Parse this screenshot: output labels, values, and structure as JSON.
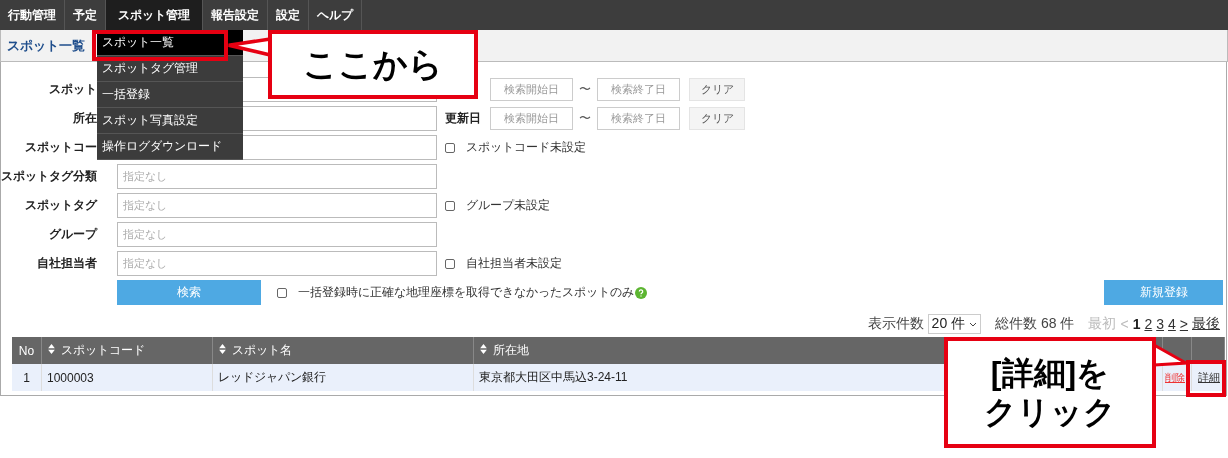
{
  "nav": {
    "tabs": [
      {
        "label": "行動管理",
        "selected": false
      },
      {
        "label": "予定",
        "selected": false
      },
      {
        "label": "スポット管理",
        "selected": true
      },
      {
        "label": "報告設定",
        "selected": false
      },
      {
        "label": "設定",
        "selected": false
      },
      {
        "label": "ヘルプ",
        "selected": false
      }
    ]
  },
  "page_title": "スポット一覧",
  "menu": {
    "items": [
      {
        "label": "スポット一覧",
        "selected": true
      },
      {
        "label": "スポットタグ管理",
        "selected": false
      },
      {
        "label": "一括登録",
        "selected": false
      },
      {
        "label": "スポット写真設定",
        "selected": false
      },
      {
        "label": "操作ログダウンロード",
        "selected": false
      }
    ]
  },
  "form": {
    "rows": [
      {
        "label": "スポット",
        "right": {
          "kind": "date_range",
          "start_placeholder": "検索開始日",
          "separator": "〜",
          "end_placeholder": "検索終了日",
          "clear": "クリア"
        }
      },
      {
        "label": "所在",
        "right": {
          "kind": "date_range",
          "label": "更新日",
          "start_placeholder": "検索開始日",
          "separator": "〜",
          "end_placeholder": "検索終了日",
          "clear": "クリア"
        }
      },
      {
        "label": "スポットコー",
        "right": {
          "kind": "checkbox",
          "label": "スポットコード未設定",
          "checked": false
        }
      },
      {
        "label": "スポットタグ分類",
        "placeholder": "指定なし"
      },
      {
        "label": "スポットタグ",
        "placeholder": "指定なし",
        "right": {
          "kind": "checkbox",
          "label": "グループ未設定",
          "checked": false
        }
      },
      {
        "label": "グループ",
        "placeholder": "指定なし"
      },
      {
        "label": "自社担当者",
        "placeholder": "指定なし",
        "right": {
          "kind": "checkbox",
          "label": "自社担当者未設定",
          "checked": false
        }
      }
    ],
    "search_button": "検索",
    "geo_checkbox": {
      "label": "一括登録時に正確な地理座標を取得できなかったスポットのみ",
      "checked": false
    },
    "new_button": "新規登録"
  },
  "pager": {
    "per_page_label": "表示件数",
    "per_page": "20 件",
    "total": "総件数 68 件",
    "first": "最初",
    "prev": "<",
    "pages": [
      {
        "label": "1",
        "selected": true
      },
      {
        "label": "2",
        "selected": false
      },
      {
        "label": "3",
        "selected": false
      },
      {
        "label": "4",
        "selected": false
      }
    ],
    "next": ">",
    "last": "最後"
  },
  "table": {
    "columns": [
      {
        "label": "No",
        "sortable": false
      },
      {
        "label": "スポットコード",
        "sortable": true
      },
      {
        "label": "スポット名",
        "sortable": true
      },
      {
        "label": "所在地",
        "sortable": true
      }
    ],
    "rows": [
      {
        "cells": [
          "1",
          "1000003",
          "レッドジャパン銀行",
          "東京都大田区中馬込3-24-11"
        ],
        "delete": "削除",
        "detail": "詳細"
      }
    ]
  },
  "callouts": [
    {
      "lines": [
        "ここから"
      ]
    },
    {
      "lines": [
        "[詳細]を",
        "クリック"
      ]
    }
  ]
}
